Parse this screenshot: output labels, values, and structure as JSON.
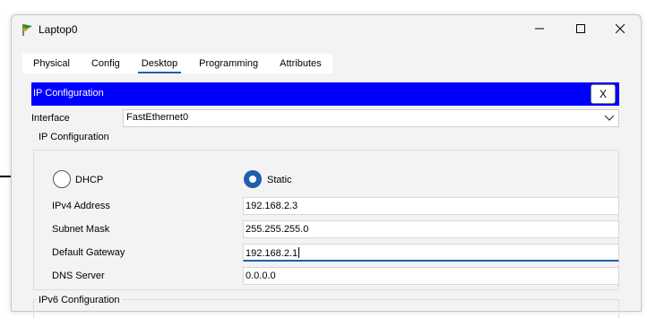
{
  "window": {
    "title": "Laptop0"
  },
  "tabs": [
    {
      "label": "Physical"
    },
    {
      "label": "Config"
    },
    {
      "label": "Desktop"
    },
    {
      "label": "Programming"
    },
    {
      "label": "Attributes"
    }
  ],
  "active_tab": "Desktop",
  "ipconfig": {
    "header_title": "IP Configuration",
    "close_label": "X",
    "interface_label": "Interface",
    "interface_value": "FastEthernet0",
    "section_title": "IP Configuration",
    "dhcp_label": "DHCP",
    "static_label": "Static",
    "mode": "Static",
    "fields": [
      {
        "label": "IPv4 Address",
        "value": "192.168.2.3"
      },
      {
        "label": "Subnet Mask",
        "value": "255.255.255.0"
      },
      {
        "label": "Default Gateway",
        "value": "192.168.2.1"
      },
      {
        "label": "DNS Server",
        "value": "0.0.0.0"
      }
    ],
    "ipv6_section_title": "IPv6 Configuration"
  },
  "colors": {
    "header_blue": "#0000fe",
    "accent": "#1f5fae"
  }
}
